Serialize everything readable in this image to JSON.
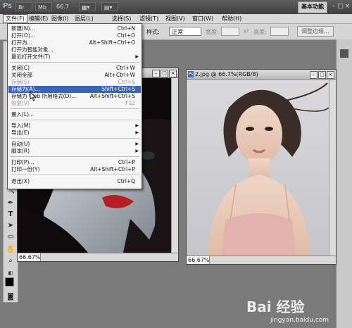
{
  "titlebar": {
    "logo": "Ps",
    "zoom": "66.7",
    "workspace": "基本功能"
  },
  "menubar": {
    "items": [
      "文件(F)",
      "编辑(E)",
      "图像(I)",
      "图层(L)",
      "选择(S)",
      "滤镜(T)",
      "视图(V)",
      "窗口(W)",
      "帮助(H)"
    ]
  },
  "options": {
    "style_label": "样式:",
    "style_value": "正常",
    "width_label": "宽度:",
    "height_label": "高度:",
    "refine_button": "调整边缘..."
  },
  "file_menu": {
    "items": [
      {
        "label": "新建(N)...",
        "shortcut": "Ctrl+N"
      },
      {
        "label": "打开(O)...",
        "shortcut": "Ctrl+O"
      },
      {
        "label": "打开为...",
        "shortcut": "Alt+Shift+Ctrl+O"
      },
      {
        "label": "打开为智能对象...",
        "shortcut": ""
      },
      {
        "label": "最近打开文件(T)",
        "shortcut": ""
      },
      {
        "label": "关闭(C)",
        "shortcut": "Ctrl+W"
      },
      {
        "label": "关闭全部",
        "shortcut": "Alt+Ctrl+W"
      },
      {
        "label": "存储(S)",
        "shortcut": "Ctrl+S"
      },
      {
        "label": "存储为(A)...",
        "shortcut": "Shift+Ctrl+S"
      },
      {
        "label": "存储为 Web 所用格式(D)...",
        "shortcut": "Alt+Shift+Ctrl+S"
      },
      {
        "label": "恢复(V)",
        "shortcut": "F12"
      },
      {
        "label": "置入(L)...",
        "shortcut": ""
      },
      {
        "label": "导入(M)",
        "shortcut": ""
      },
      {
        "label": "导出(E)",
        "shortcut": ""
      },
      {
        "label": "自动(U)",
        "shortcut": ""
      },
      {
        "label": "脚本(R)",
        "shortcut": ""
      },
      {
        "label": "打印(P)...",
        "shortcut": "Ctrl+P"
      },
      {
        "label": "打印一份(Y)",
        "shortcut": "Alt+Shift+Ctrl+P"
      },
      {
        "label": "退出(X)",
        "shortcut": "Ctrl+Q"
      }
    ]
  },
  "doc1": {
    "zoom": "66.67%"
  },
  "doc2": {
    "title": "2.jpg @ 66.7%(RGB/8)",
    "zoom": "66.67%"
  },
  "watermark": {
    "brand": "Bai 经验",
    "site": "jingyan.baidu.com"
  },
  "colors": {
    "accent": "#3a64b5",
    "foreground": "#000000",
    "background": "#ffffff"
  }
}
